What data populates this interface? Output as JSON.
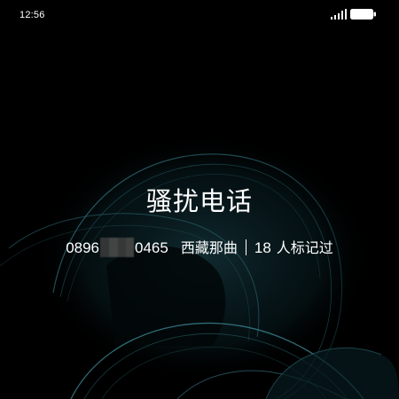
{
  "status_bar": {
    "time": "12:56",
    "signal_icon": "signal-bars-icon",
    "battery_icon": "battery-full-icon"
  },
  "incoming_call": {
    "label": "骚扰电话",
    "number_prefix": "0896",
    "number_suffix": "0465",
    "location": "西藏那曲",
    "mark_count": "18",
    "mark_text": "人标记过"
  },
  "colors": {
    "background": "#000000",
    "text": "#ffffff",
    "wallpaper_accent": "#2e6f7a"
  }
}
